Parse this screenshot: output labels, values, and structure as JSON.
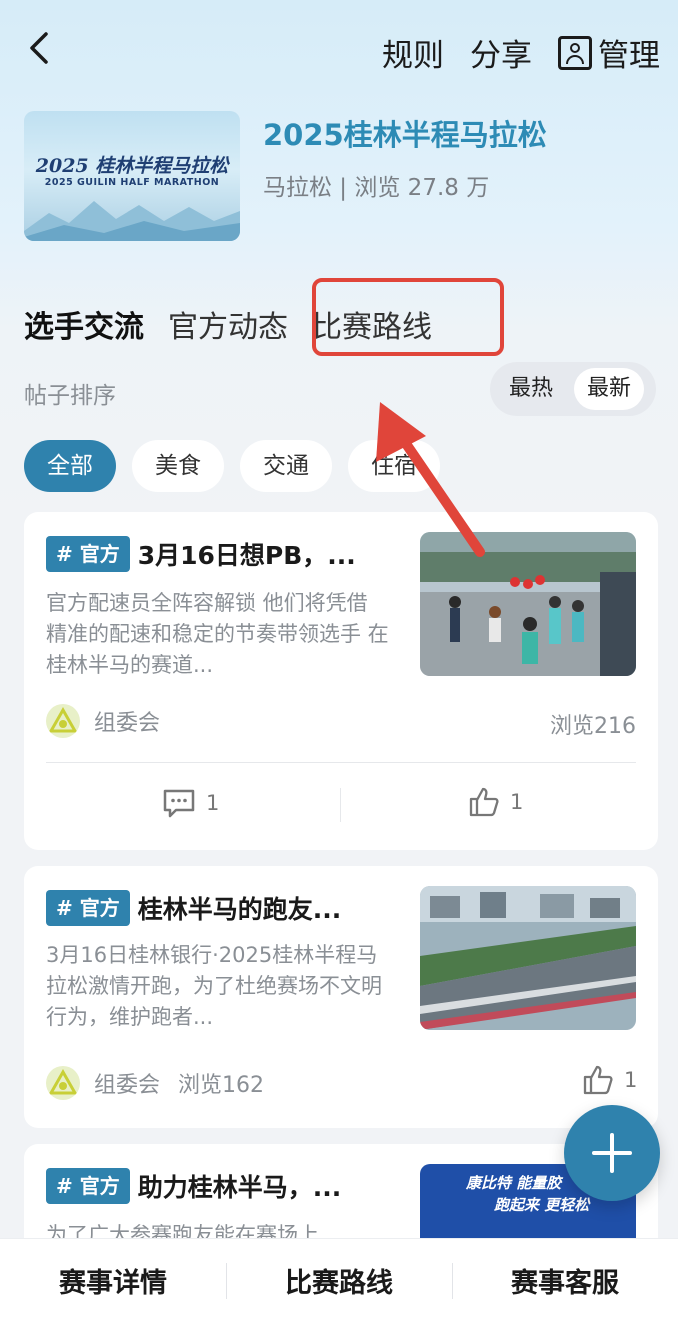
{
  "nav": {
    "back_icon": "chevron-left-icon",
    "rules": "规则",
    "share": "分享",
    "manage": "管理"
  },
  "event": {
    "title": "2025桂林半程马拉松",
    "meta": "马拉松 | 浏览 27.8 万",
    "thumb_title": "2025 桂林半程马拉松",
    "thumb_subtitle": "2025 GUILIN HALF MARATHON"
  },
  "tabs": [
    {
      "label": "选手交流",
      "active": true
    },
    {
      "label": "官方动态",
      "active": false
    },
    {
      "label": "比赛路线",
      "active": false
    }
  ],
  "sort": {
    "label": "帖子排序",
    "options": [
      "最热",
      "最新"
    ],
    "selected": "最新"
  },
  "chips": [
    "全部",
    "美食",
    "交通",
    "住宿"
  ],
  "posts": [
    {
      "badge": "# 官方",
      "title": "3月16日想PB，...",
      "excerpt": "官方配速员全阵容解锁 他们将凭借 精准的配速和稳定的节奏带领选手 在桂林半马的赛道...",
      "author": "组委会",
      "views": "浏览216",
      "comments": "1",
      "likes": "1"
    },
    {
      "badge": "# 官方",
      "title": "桂林半马的跑友...",
      "excerpt": "3月16日桂林银行·2025桂林半程马拉松激情开跑，为了杜绝赛场不文明行为，维护跑者...",
      "author": "组委会",
      "views": "浏览162",
      "likes": "1"
    },
    {
      "badge": "# 官方",
      "title": "助力桂林半马，...",
      "excerpt": "为了广大参赛跑友能在赛场上",
      "img_text_1": "康比特 能量胶",
      "img_text_2": "跑起来 更轻松"
    }
  ],
  "bottom_bar": [
    "赛事详情",
    "比赛路线",
    "赛事客服"
  ],
  "colors": {
    "accent": "#2f82ad",
    "title_blue": "#2d8bb5",
    "annotation_red": "#e0453a"
  }
}
